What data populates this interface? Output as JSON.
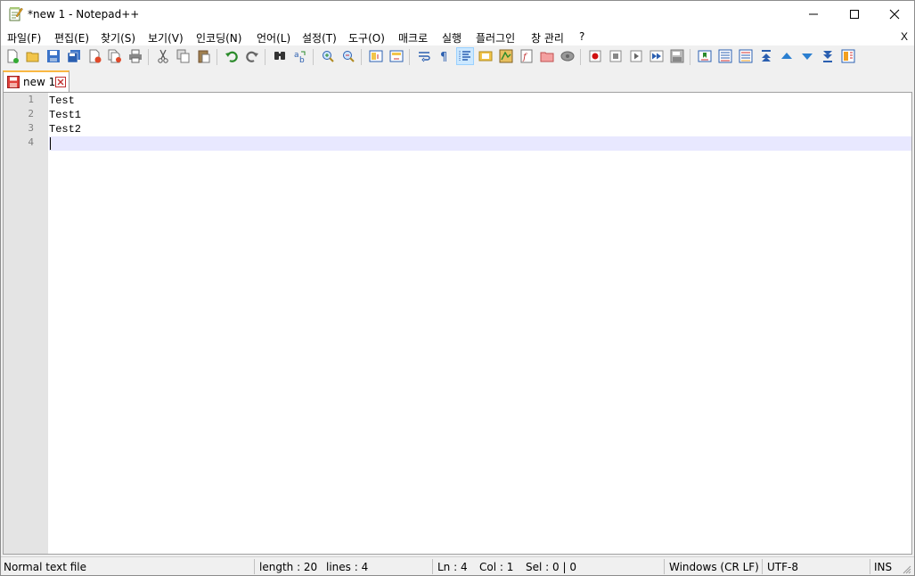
{
  "window": {
    "title": "*new 1 - Notepad++",
    "app_icon": "notepad-plus-plus-icon",
    "controls": [
      "minimize-icon",
      "maximize-icon",
      "close-icon"
    ]
  },
  "menu": {
    "items": [
      "파일(F)",
      "편집(E)",
      "찾기(S)",
      "보기(V)",
      "인코딩(N)",
      "언어(L)",
      "설정(T)",
      "도구(O)",
      "매크로",
      "실행",
      "플러그인",
      "창 관리",
      "?"
    ],
    "close_label": "X"
  },
  "toolbar": {
    "icons": [
      "new-file-icon",
      "open-file-icon",
      "save-icon",
      "save-all-icon",
      "close-icon",
      "close-all-icon",
      "print-icon",
      "cut-icon",
      "copy-icon",
      "paste-icon",
      "undo-icon",
      "redo-icon",
      "find-icon",
      "replace-icon",
      "zoom-in-icon",
      "zoom-out-icon",
      "sync-vertical-icon",
      "sync-horizontal-icon",
      "word-wrap-icon",
      "show-all-chars-icon",
      "indent-guide-icon",
      "udl-icon",
      "doc-map-icon",
      "function-list-icon",
      "folder-workspace-icon",
      "monitoring-icon",
      "record-macro-icon",
      "stop-macro-icon",
      "play-macro-icon",
      "run-macro-multiple-icon",
      "save-macro-icon",
      "bookmark-icon",
      "compare-icon",
      "compare-clear-icon",
      "first-diff-icon",
      "prev-diff-icon",
      "next-diff-icon",
      "last-diff-icon",
      "navigation-bar-icon"
    ],
    "active_icon": "indent-guide-icon"
  },
  "tabs": [
    {
      "label": "new 1",
      "modified": true
    }
  ],
  "editor": {
    "lines": [
      "Test",
      "Test1",
      "Test2",
      ""
    ],
    "line_numbers": [
      "1",
      "2",
      "3",
      "4"
    ],
    "current_line": 4
  },
  "status": {
    "file_type": "Normal text file",
    "length": "length : 20",
    "lines": "lines : 4",
    "ln": "Ln : 4",
    "col": "Col : 1",
    "sel": "Sel : 0 | 0",
    "eol": "Windows (CR LF)",
    "encoding": "UTF-8",
    "mode": "INS"
  },
  "colors": {
    "accent_tab": "#fab842",
    "current_line": "#e8e8ff",
    "gutter": "#e4e4e4"
  }
}
